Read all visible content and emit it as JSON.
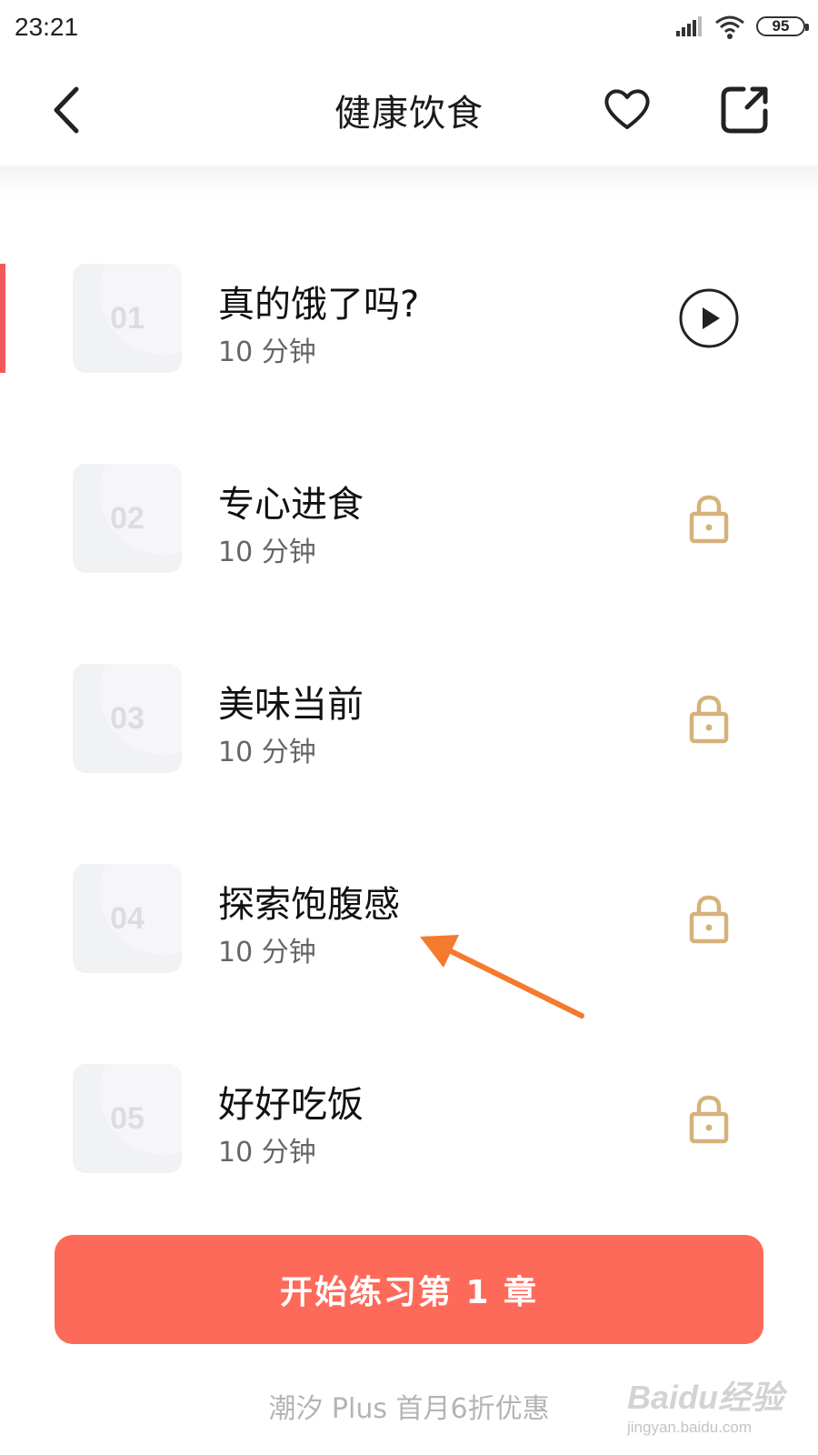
{
  "status_bar": {
    "time": "23:21",
    "battery": "95"
  },
  "header": {
    "title": "健康饮食"
  },
  "chapters": [
    {
      "num": "01",
      "title": "真的饿了吗?",
      "duration": "10 分钟",
      "state": "play"
    },
    {
      "num": "02",
      "title": "专心进食",
      "duration": "10 分钟",
      "state": "locked"
    },
    {
      "num": "03",
      "title": "美味当前",
      "duration": "10 分钟",
      "state": "locked"
    },
    {
      "num": "04",
      "title": "探索饱腹感",
      "duration": "10 分钟",
      "state": "locked"
    },
    {
      "num": "05",
      "title": "好好吃饭",
      "duration": "10 分钟",
      "state": "locked"
    }
  ],
  "start_button": {
    "label": "开始练习第 1 章"
  },
  "promo": {
    "text": "潮汐 Plus 首月6折优惠"
  },
  "watermark": {
    "logo": "Baidu经验",
    "url": "jingyan.baidu.com"
  },
  "colors": {
    "accent": "#fd6a5a",
    "lock": "#d4b27a",
    "active_marker": "#f2595a",
    "annotation_arrow": "#f47a2d"
  },
  "icons": {
    "back": "chevron-left-icon",
    "favorite": "heart-icon",
    "share": "share-icon",
    "play": "play-circle-icon",
    "lock": "lock-icon"
  }
}
